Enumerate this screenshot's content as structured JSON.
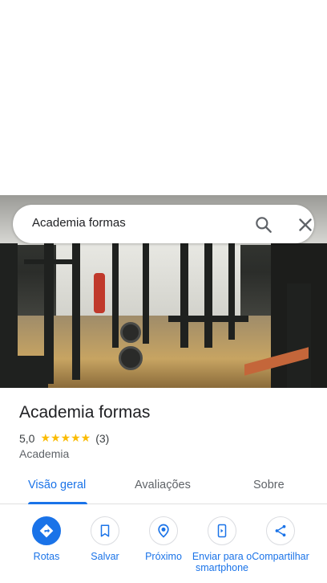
{
  "search": {
    "query": "Academia formas"
  },
  "place": {
    "title": "Academia formas",
    "rating": "5,0",
    "stars": "★★★★★",
    "review_count": "(3)",
    "category": "Academia"
  },
  "tabs": [
    {
      "label": "Visão geral",
      "active": true
    },
    {
      "label": "Avaliações",
      "active": false
    },
    {
      "label": "Sobre",
      "active": false
    }
  ],
  "actions": [
    {
      "label": "Rotas",
      "icon": "directions-icon"
    },
    {
      "label": "Salvar",
      "icon": "bookmark-icon"
    },
    {
      "label": "Próximo",
      "icon": "nearby-icon"
    },
    {
      "label": "Enviar para o smartphone",
      "icon": "send-to-phone-icon"
    },
    {
      "label": "Compartilhar",
      "icon": "share-icon"
    }
  ],
  "colors": {
    "accent": "#1a73e8",
    "star": "#fbbc04",
    "text": "#202124",
    "muted": "#5f6368"
  }
}
